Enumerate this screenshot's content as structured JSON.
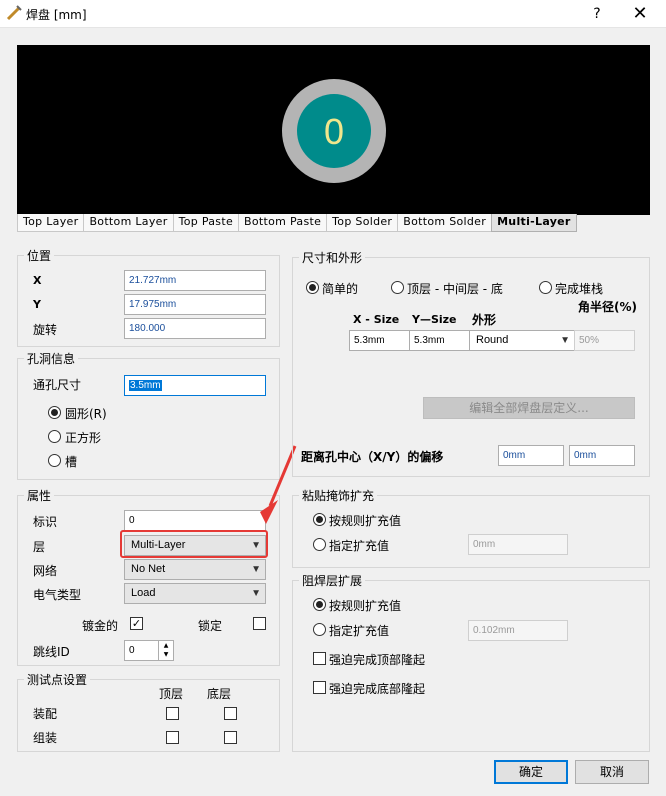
{
  "window": {
    "title": "焊盘 [mm]",
    "help": "?",
    "close": "✕"
  },
  "preview": {
    "pad_label": "0",
    "pad_color": "#008b8b",
    "ring_color": "#b4b4b4"
  },
  "tabs": [
    "Top Layer",
    "Bottom Layer",
    "Top Paste",
    "Bottom Paste",
    "Top Solder",
    "Bottom Solder",
    "Multi-Layer"
  ],
  "location": {
    "title": "位置",
    "x_label": "X",
    "x_value": "21.727mm",
    "y_label": "Y",
    "y_value": "17.975mm",
    "rot_label": "旋转",
    "rot_value": "180.000"
  },
  "hole": {
    "title": "孔洞信息",
    "size_label": "通孔尺寸",
    "size_value": "3.5mm",
    "options": [
      "圆形(R)",
      "正方形",
      "槽"
    ]
  },
  "properties": {
    "title": "属性",
    "designator_label": "标识",
    "designator_value": "0",
    "layer_label": "层",
    "layer_value": "Multi-Layer",
    "net_label": "网络",
    "net_value": "No Net",
    "etype_label": "电气类型",
    "etype_value": "Load",
    "plated_label": "镀金的",
    "plated_check": "✓",
    "locked_label": "锁定",
    "jumper_label": "跳线ID",
    "jumper_value": "0"
  },
  "testpoint": {
    "title": "测试点设置",
    "top": "顶层",
    "bottom": "底层",
    "assembly": "装配",
    "fab": "组装"
  },
  "size_shape": {
    "title": "尺寸和外形",
    "options": [
      "简单的",
      "顶层 - 中间层 - 底",
      "完成堆栈"
    ],
    "corner_radius_label": "角半径(%)",
    "x_size_label": "X - Size",
    "y_size_label": "Y—Size",
    "shape_label": "外形",
    "x_size": "5.3mm",
    "y_size": "5.3mm",
    "shape": "Round",
    "corner_value": "50%",
    "edit_button": "编辑全部焊盘层定义...",
    "offset_label": "距离孔中心（X/Y）的偏移",
    "offset_x": "0mm",
    "offset_y": "0mm"
  },
  "paste": {
    "title": "粘贴掩饰扩充",
    "rule": "按规则扩充值",
    "specified": "指定扩充值",
    "value": "0mm"
  },
  "solder": {
    "title": "阻焊层扩展",
    "rule": "按规则扩充值",
    "specified": "指定扩充值",
    "value": "0.102mm",
    "force_top": "强迫完成顶部隆起",
    "force_bottom": "强迫完成底部隆起"
  },
  "buttons": {
    "ok": "确定",
    "cancel": "取消"
  },
  "annotation": {
    "color": "#e53935"
  }
}
